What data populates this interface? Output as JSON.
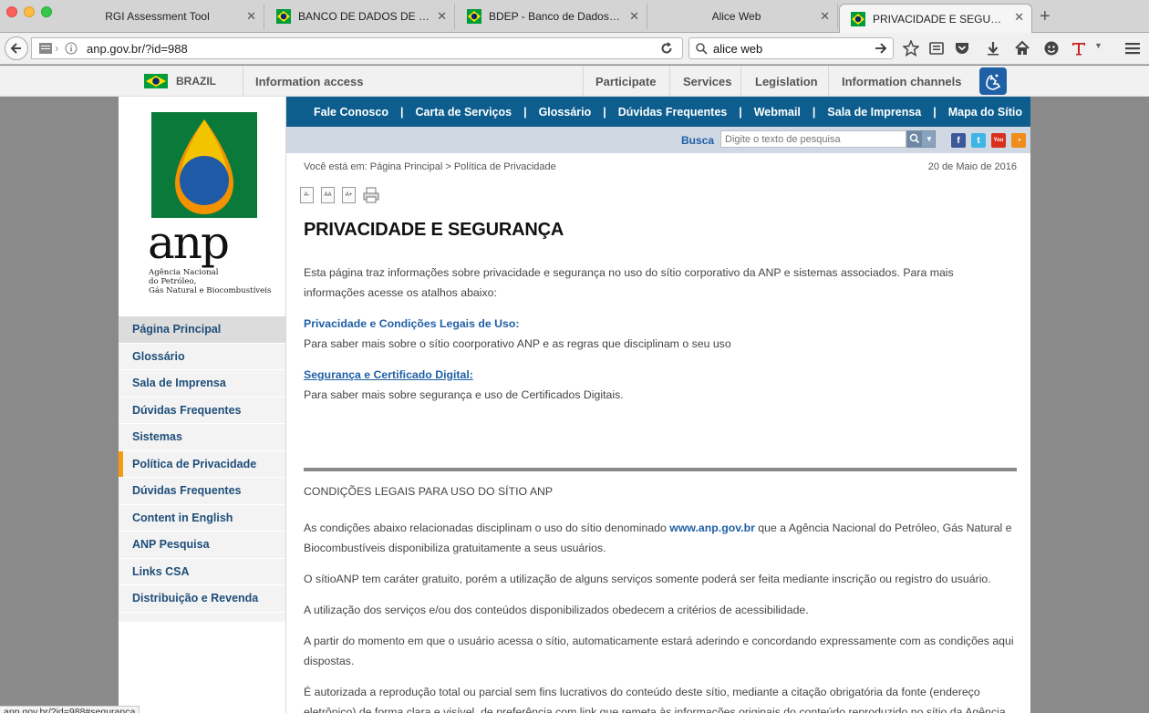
{
  "browser": {
    "tabs": [
      {
        "label": "RGI Assessment Tool",
        "favicon": false,
        "active": false
      },
      {
        "label": "BANCO DE DADOS DE EX...",
        "favicon": true,
        "active": false
      },
      {
        "label": "BDEP - Banco de Dados de...",
        "favicon": true,
        "active": false
      },
      {
        "label": "Alice Web",
        "favicon": false,
        "active": false
      },
      {
        "label": "PRIVACIDADE E SEGURAN...",
        "favicon": true,
        "active": true
      }
    ],
    "url": "anp.gov.br/?id=988",
    "search_value": "alice web",
    "status_url": "anp.gov.br/?id=988#seguranca"
  },
  "govbar": {
    "country": "BRAZIL",
    "information_access": "Information access",
    "items": [
      "Participate",
      "Services",
      "Legislation",
      "Information channels"
    ]
  },
  "logo": {
    "text": "anp",
    "subtitle": [
      "Agência Nacional",
      "do Petróleo,",
      "Gás Natural e Biocombustíveis"
    ]
  },
  "topnav": [
    "Fale Conosco",
    "Carta de Serviços",
    "Glossário",
    "Dúvidas Frequentes",
    "Webmail",
    "Sala de Imprensa",
    "Mapa do Sítio"
  ],
  "search": {
    "label": "Busca",
    "placeholder": "Digite o texto de pesquisa"
  },
  "social_icons": [
    "facebook-icon",
    "twitter-icon",
    "youtube-icon",
    "rss-icon"
  ],
  "sidebar": {
    "items": [
      {
        "label": "Página Principal",
        "state": "current"
      },
      {
        "label": "Glossário",
        "state": ""
      },
      {
        "label": "Sala de Imprensa",
        "state": ""
      },
      {
        "label": "Dúvidas Frequentes",
        "state": ""
      },
      {
        "label": "Sistemas",
        "state": ""
      },
      {
        "label": "Política de Privacidade",
        "state": "selected"
      },
      {
        "label": "Dúvidas Frequentes",
        "state": ""
      },
      {
        "label": "Content in English",
        "state": ""
      },
      {
        "label": "ANP Pesquisa",
        "state": ""
      },
      {
        "label": "Links CSA",
        "state": ""
      },
      {
        "label": "Distribuição e Revenda",
        "state": ""
      }
    ]
  },
  "main": {
    "breadcrumb_prefix": "Você está em:",
    "breadcrumb_home": "Página Principal",
    "breadcrumb_sep": ">",
    "breadcrumb_current": "Política de Privacidade",
    "date": "20 de Maio de 2016",
    "font_tools": [
      "A-",
      "AA",
      "A+"
    ],
    "title": "PRIVACIDADE E SEGURANÇA",
    "intro": "Esta página traz informações sobre privacidade e segurança no uso do sítio corporativo da ANP e sistemas associados.  Para mais informações acesse os atalhos abaixo:",
    "link1_title": "Privacidade e Condições Legais de Uso:",
    "link1_text": "Para saber mais sobre o sítio coorporativo ANP e as regras que disciplinam o seu uso",
    "link2_title": "Segurança e Certificado Digital:",
    "link2_text": "Para saber mais sobre segurança e uso de Certificados Digitais.",
    "section_heading": "CONDIÇÕES LEGAIS PARA USO DO SÍTIO ANP",
    "p1_before": "As condições abaixo relacionadas disciplinam o uso do sítio denominado ",
    "p1_link": "www.anp.gov.br",
    "p1_after": " que a Agência Nacional do Petróleo, Gás Natural e Biocombustíveis disponibiliza gratuitamente a seus usuários.",
    "p2": "O sítioANP tem caráter gratuito, porém a utilização de alguns serviços somente poderá ser feita mediante inscrição ou registro do usuário.",
    "p3": "A utilização dos serviços e/ou dos conteúdos disponibilizados obedecem a critérios de acessibilidade.",
    "p4": "A partir do momento em que o usuário acessa o sítio, automaticamente estará aderindo e concordando expressamente com as condições aqui dispostas.",
    "p5": "É autorizada a reprodução total ou parcial sem fins lucrativos do conteúdo deste sítio, mediante a citação obrigatória da fonte (endereço eletrônico) de forma clara e visível, de preferência com link que remeta às informações originais do conteúdo reproduzido no sítio da Agência."
  },
  "colors": {
    "nav_blue": "#0d5e8e",
    "link_blue": "#1f5fa6",
    "selected_marker": "#f39c12",
    "logo_green": "#0a7a3b",
    "logo_yellow": "#f2c400",
    "logo_orange": "#f39200",
    "logo_blue": "#1f5aa6"
  }
}
